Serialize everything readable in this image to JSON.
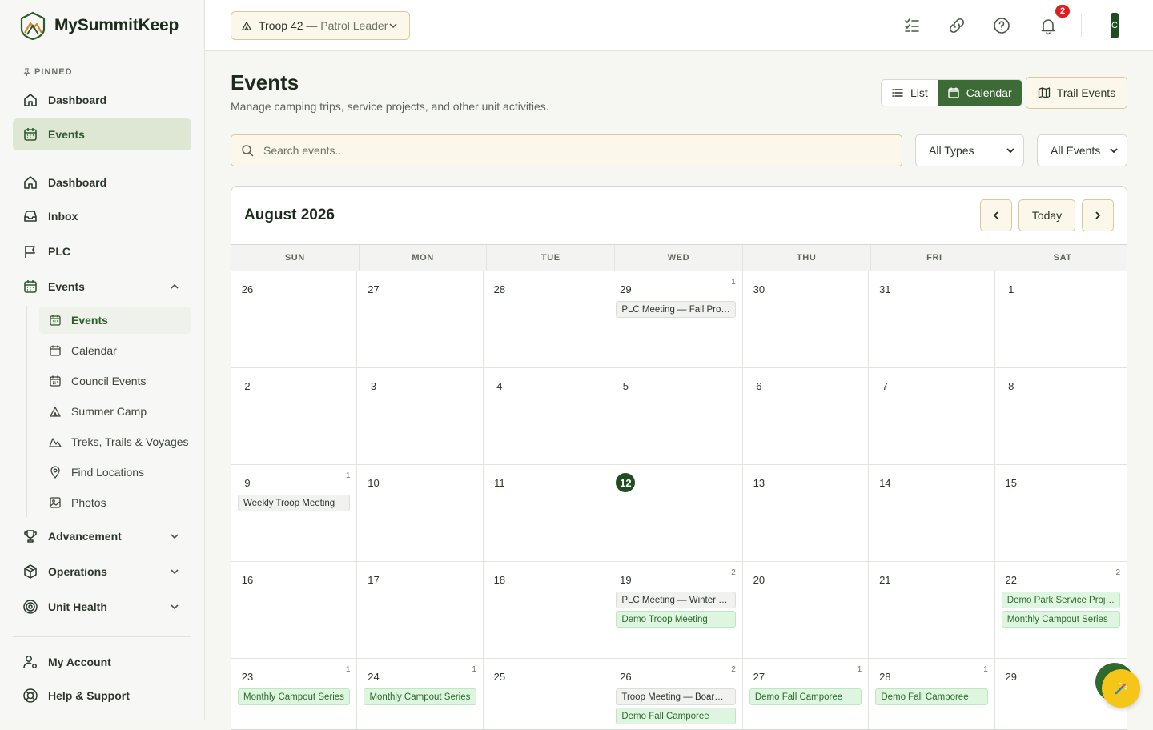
{
  "brand": {
    "name": "MySummitKeep"
  },
  "sidebar": {
    "pinned_label": "PINNED",
    "pinned": [
      {
        "label": "Dashboard",
        "icon": "home-icon"
      },
      {
        "label": "Events",
        "icon": "calendar-icon"
      }
    ],
    "main": [
      {
        "label": "Dashboard",
        "icon": "home-icon"
      },
      {
        "label": "Inbox",
        "icon": "inbox-icon"
      },
      {
        "label": "PLC",
        "icon": "flag-icon"
      },
      {
        "label": "Events",
        "icon": "calendar-icon"
      }
    ],
    "events_sub": [
      {
        "label": "Events",
        "icon": "calendar-icon"
      },
      {
        "label": "Calendar",
        "icon": "calendar-icon"
      },
      {
        "label": "Council Events",
        "icon": "calendar-icon"
      },
      {
        "label": "Summer Camp",
        "icon": "tent-icon"
      },
      {
        "label": "Treks, Trails & Voyages",
        "icon": "mountain-icon"
      },
      {
        "label": "Find Locations",
        "icon": "map-pin-icon"
      },
      {
        "label": "Photos",
        "icon": "image-icon"
      }
    ],
    "groups": [
      {
        "label": "Advancement",
        "icon": "trophy-icon"
      },
      {
        "label": "Operations",
        "icon": "box-icon"
      },
      {
        "label": "Unit Health",
        "icon": "target-icon"
      }
    ],
    "footer": [
      {
        "label": "My Account",
        "icon": "user-gear-icon"
      },
      {
        "label": "Help & Support",
        "icon": "lifebuoy-icon"
      }
    ]
  },
  "topbar": {
    "troop": "Troop 42",
    "role": " — Patrol Leader",
    "notification_count": "2",
    "avatar_initial": "C"
  },
  "page": {
    "title": "Events",
    "subtitle": "Manage camping trips, service projects, and other unit activities.",
    "view_list": "List",
    "view_calendar": "Calendar",
    "trail_events": "Trail Events",
    "search_placeholder": "Search events...",
    "type_filter": "All Types",
    "scope_filter": "All Events"
  },
  "calendar": {
    "month": "August 2026",
    "today_label": "Today",
    "dow": [
      "SUN",
      "MON",
      "TUE",
      "WED",
      "THU",
      "FRI",
      "SAT"
    ],
    "days": [
      {
        "n": "26",
        "count": "",
        "events": []
      },
      {
        "n": "27",
        "count": "",
        "events": []
      },
      {
        "n": "28",
        "count": "",
        "events": []
      },
      {
        "n": "29",
        "count": "1",
        "events": [
          {
            "t": "PLC Meeting — Fall Pro…",
            "c": "gray"
          }
        ]
      },
      {
        "n": "30",
        "count": "",
        "events": []
      },
      {
        "n": "31",
        "count": "",
        "events": []
      },
      {
        "n": "1",
        "count": "",
        "events": []
      },
      {
        "n": "2",
        "count": "",
        "events": []
      },
      {
        "n": "3",
        "count": "",
        "events": []
      },
      {
        "n": "4",
        "count": "",
        "events": []
      },
      {
        "n": "5",
        "count": "",
        "events": []
      },
      {
        "n": "6",
        "count": "",
        "events": []
      },
      {
        "n": "7",
        "count": "",
        "events": []
      },
      {
        "n": "8",
        "count": "",
        "events": []
      },
      {
        "n": "9",
        "count": "1",
        "events": [
          {
            "t": "Weekly Troop Meeting",
            "c": "gray"
          }
        ]
      },
      {
        "n": "10",
        "count": "",
        "events": []
      },
      {
        "n": "11",
        "count": "",
        "events": []
      },
      {
        "n": "12",
        "count": "",
        "today": true,
        "events": []
      },
      {
        "n": "13",
        "count": "",
        "events": []
      },
      {
        "n": "14",
        "count": "",
        "events": []
      },
      {
        "n": "15",
        "count": "",
        "events": []
      },
      {
        "n": "16",
        "count": "",
        "events": []
      },
      {
        "n": "17",
        "count": "",
        "events": []
      },
      {
        "n": "18",
        "count": "",
        "events": []
      },
      {
        "n": "19",
        "count": "2",
        "events": [
          {
            "t": "PLC Meeting — Winter …",
            "c": "gray"
          },
          {
            "t": "Demo Troop Meeting",
            "c": "green"
          }
        ]
      },
      {
        "n": "20",
        "count": "",
        "events": []
      },
      {
        "n": "21",
        "count": "",
        "events": []
      },
      {
        "n": "22",
        "count": "2",
        "events": [
          {
            "t": "Demo Park Service Proj…",
            "c": "green"
          },
          {
            "t": "Monthly Campout Series",
            "c": "green"
          }
        ]
      },
      {
        "n": "23",
        "count": "1",
        "events": [
          {
            "t": "Monthly Campout Series",
            "c": "green"
          }
        ]
      },
      {
        "n": "24",
        "count": "1",
        "events": [
          {
            "t": "Monthly Campout Series",
            "c": "green"
          }
        ]
      },
      {
        "n": "25",
        "count": "",
        "events": []
      },
      {
        "n": "26",
        "count": "2",
        "events": [
          {
            "t": "Troop Meeting — Boar…",
            "c": "gray"
          },
          {
            "t": "Demo Fall Camporee",
            "c": "green"
          }
        ]
      },
      {
        "n": "27",
        "count": "1",
        "events": [
          {
            "t": "Demo Fall Camporee",
            "c": "green"
          }
        ]
      },
      {
        "n": "28",
        "count": "1",
        "events": [
          {
            "t": "Demo Fall Camporee",
            "c": "green"
          }
        ]
      },
      {
        "n": "29",
        "count": "",
        "events": []
      }
    ]
  },
  "colors": {
    "accent": "#3d6b35",
    "today": "#1f4d1f",
    "cream": "#fbf7ea",
    "badge": "#d91f1f",
    "fab": "#f5c518"
  }
}
